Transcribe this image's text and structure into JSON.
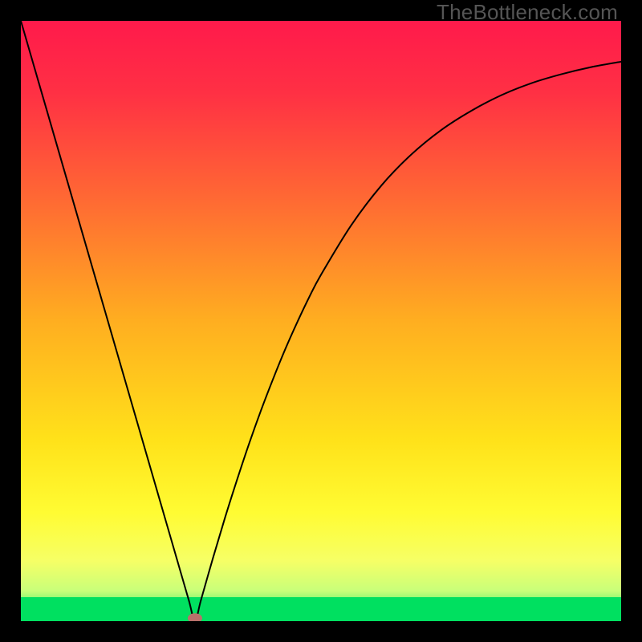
{
  "watermark": "TheBottleneck.com",
  "chart_data": {
    "type": "line",
    "title": "",
    "xlabel": "",
    "ylabel": "",
    "xlim": [
      0,
      100
    ],
    "ylim": [
      0,
      100
    ],
    "grid": false,
    "legend": false,
    "series": [
      {
        "name": "curve",
        "x": [
          0,
          2,
          4,
          6,
          8,
          10,
          12,
          14,
          16,
          18,
          20,
          22,
          24,
          26,
          28,
          29,
          30,
          32,
          34,
          36,
          38,
          40,
          42,
          44,
          46,
          48,
          50,
          55,
          60,
          65,
          70,
          75,
          80,
          85,
          90,
          95,
          100
        ],
        "y": [
          100,
          93.1,
          86.2,
          79.3,
          72.4,
          65.5,
          58.6,
          51.7,
          44.8,
          37.9,
          31.0,
          24.1,
          17.2,
          10.3,
          3.4,
          0.0,
          3.5,
          10.5,
          17.2,
          23.5,
          29.5,
          35.1,
          40.3,
          45.2,
          49.7,
          53.9,
          57.7,
          65.9,
          72.5,
          77.7,
          81.8,
          85.0,
          87.6,
          89.6,
          91.1,
          92.3,
          93.2
        ]
      }
    ],
    "marker": {
      "x": 29,
      "y": 0.5,
      "color": "#b9716b"
    },
    "green_band_top_y": 4.0,
    "gradient_stops": [
      {
        "offset": 0.0,
        "color": "#ff1a4b"
      },
      {
        "offset": 0.12,
        "color": "#ff3044"
      },
      {
        "offset": 0.3,
        "color": "#ff6a33"
      },
      {
        "offset": 0.5,
        "color": "#ffae20"
      },
      {
        "offset": 0.7,
        "color": "#ffe21a"
      },
      {
        "offset": 0.82,
        "color": "#fffc33"
      },
      {
        "offset": 0.9,
        "color": "#f6ff66"
      },
      {
        "offset": 0.95,
        "color": "#c8ff7a"
      },
      {
        "offset": 1.0,
        "color": "#00e060"
      }
    ]
  }
}
